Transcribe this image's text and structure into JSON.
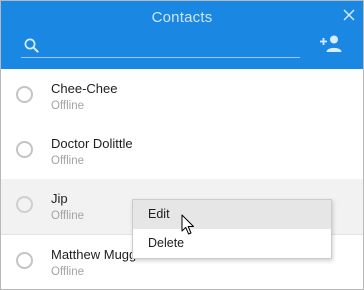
{
  "header": {
    "title": "Contacts",
    "background": "#1a87e3",
    "search": {
      "value": "",
      "placeholder": ""
    },
    "icons": {
      "close": "close-icon",
      "search": "search-icon",
      "add_contact": "add-person-icon"
    }
  },
  "contacts": [
    {
      "name": "Chee-Chee",
      "status": "Offline"
    },
    {
      "name": "Doctor Dolittle",
      "status": "Offline"
    },
    {
      "name": "Jip",
      "status": "Offline"
    },
    {
      "name": "Matthew Mugg",
      "status": "Offline"
    }
  ],
  "context_menu": {
    "items": [
      {
        "label": "Edit"
      },
      {
        "label": "Delete"
      }
    ]
  }
}
